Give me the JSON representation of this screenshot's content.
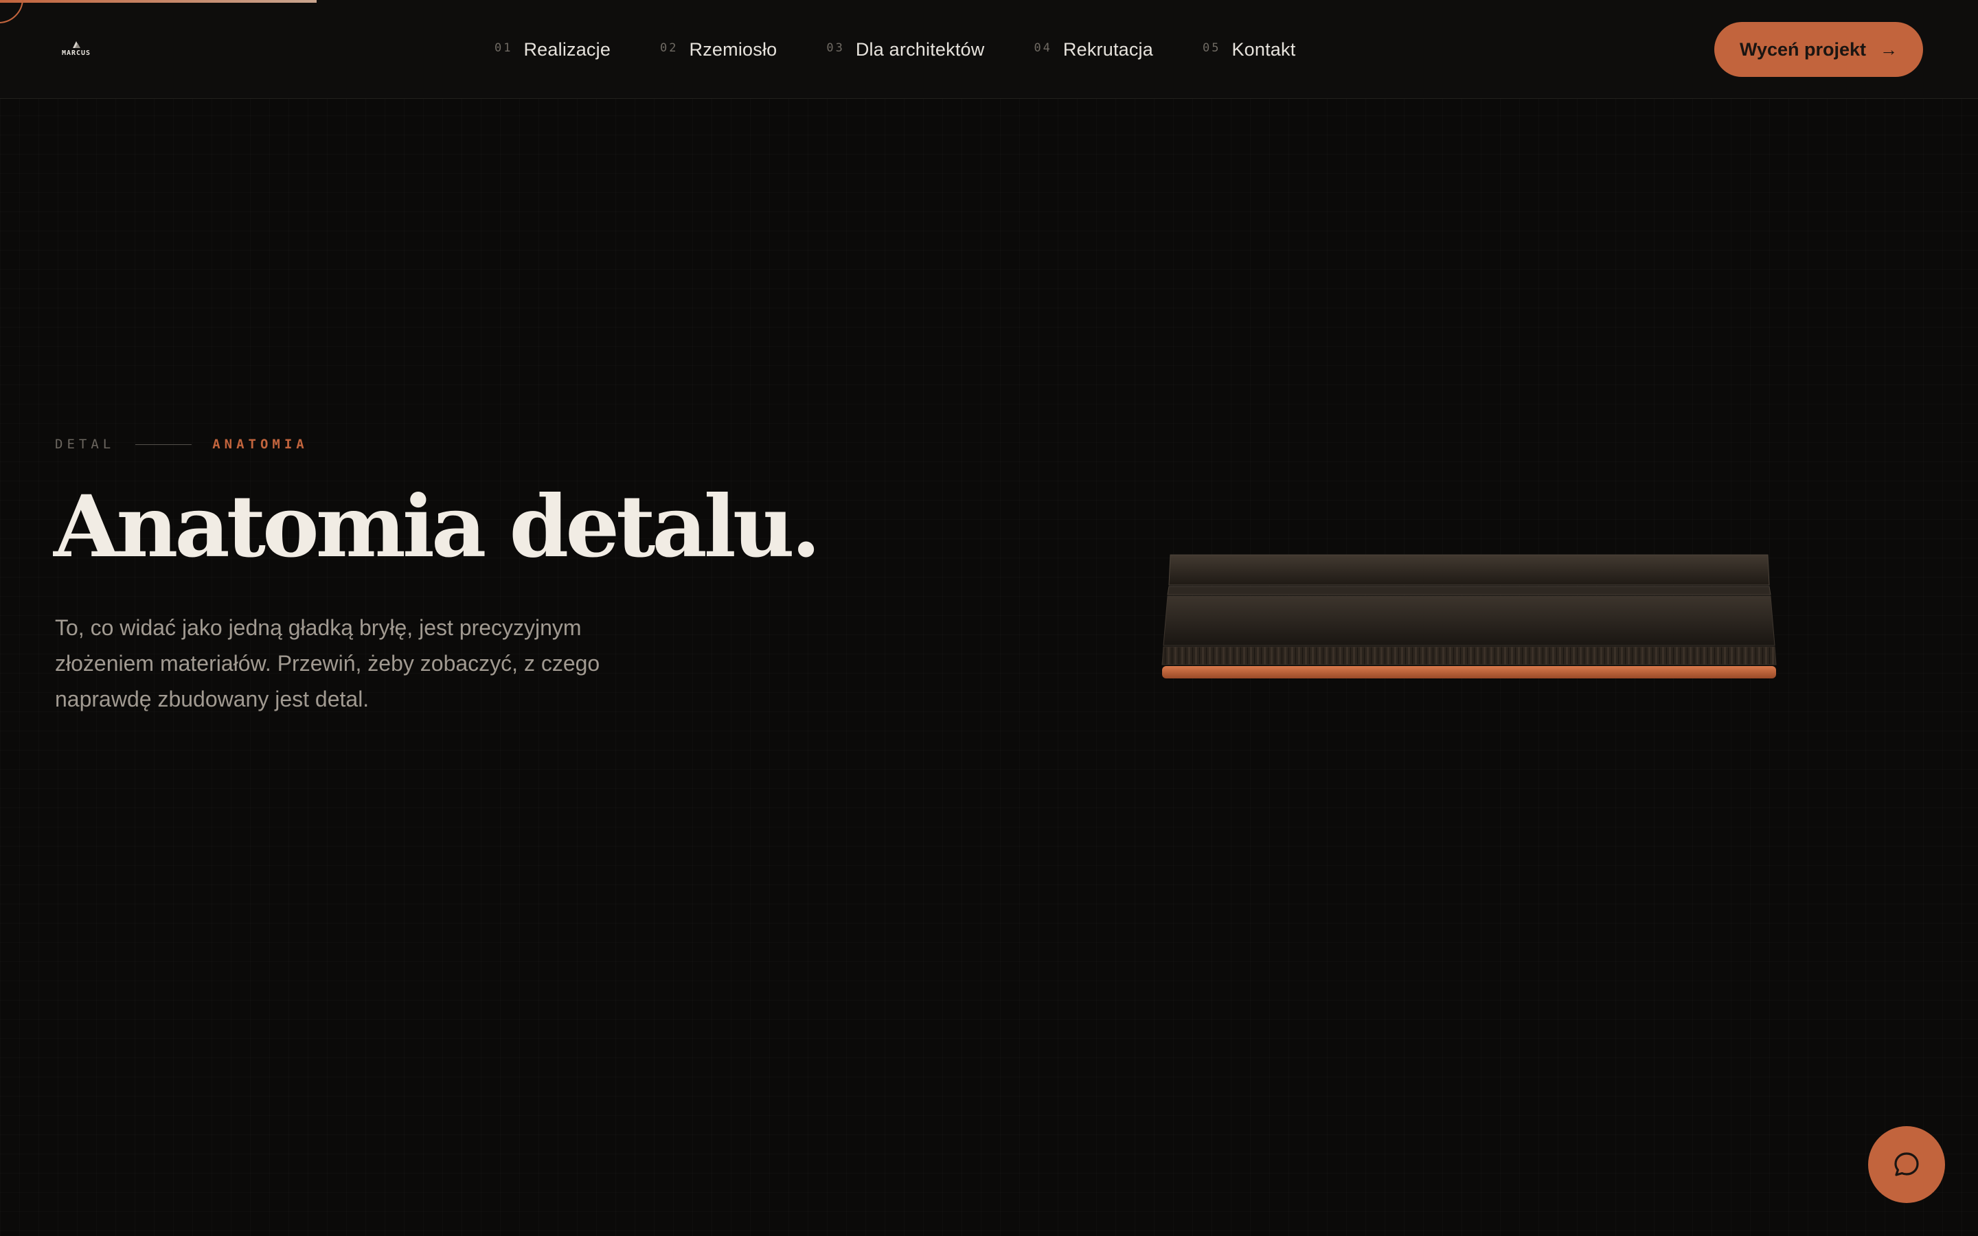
{
  "progress": {
    "value": 0.16
  },
  "brand": {
    "logo_text": "MARCUS"
  },
  "nav": {
    "items": [
      {
        "num": "01",
        "label": "Realizacje"
      },
      {
        "num": "02",
        "label": "Rzemiosło"
      },
      {
        "num": "03",
        "label": "Dla architektów"
      },
      {
        "num": "04",
        "label": "Rekrutacja"
      },
      {
        "num": "05",
        "label": "Kontakt"
      }
    ]
  },
  "cta": {
    "label": "Wyceń projekt",
    "arrow": "→"
  },
  "hero": {
    "eyebrow_left": "DETAL",
    "eyebrow_right": "ANATOMIA",
    "title": "Anatomia detalu.",
    "lead": "To, co widać jako jedną gładką bryłę, jest precyzyjnym złożeniem materiałów. Przewiń, żeby zobaczyć, z czego naprawdę zbudowany jest detal."
  },
  "icons": {
    "chat": "chat-bubble-icon",
    "logo": "logo-mark-icon"
  },
  "colors": {
    "accent": "#c2643d",
    "background": "#0b0a09",
    "text_primary": "#f1ece4",
    "text_secondary": "#a19a91"
  }
}
